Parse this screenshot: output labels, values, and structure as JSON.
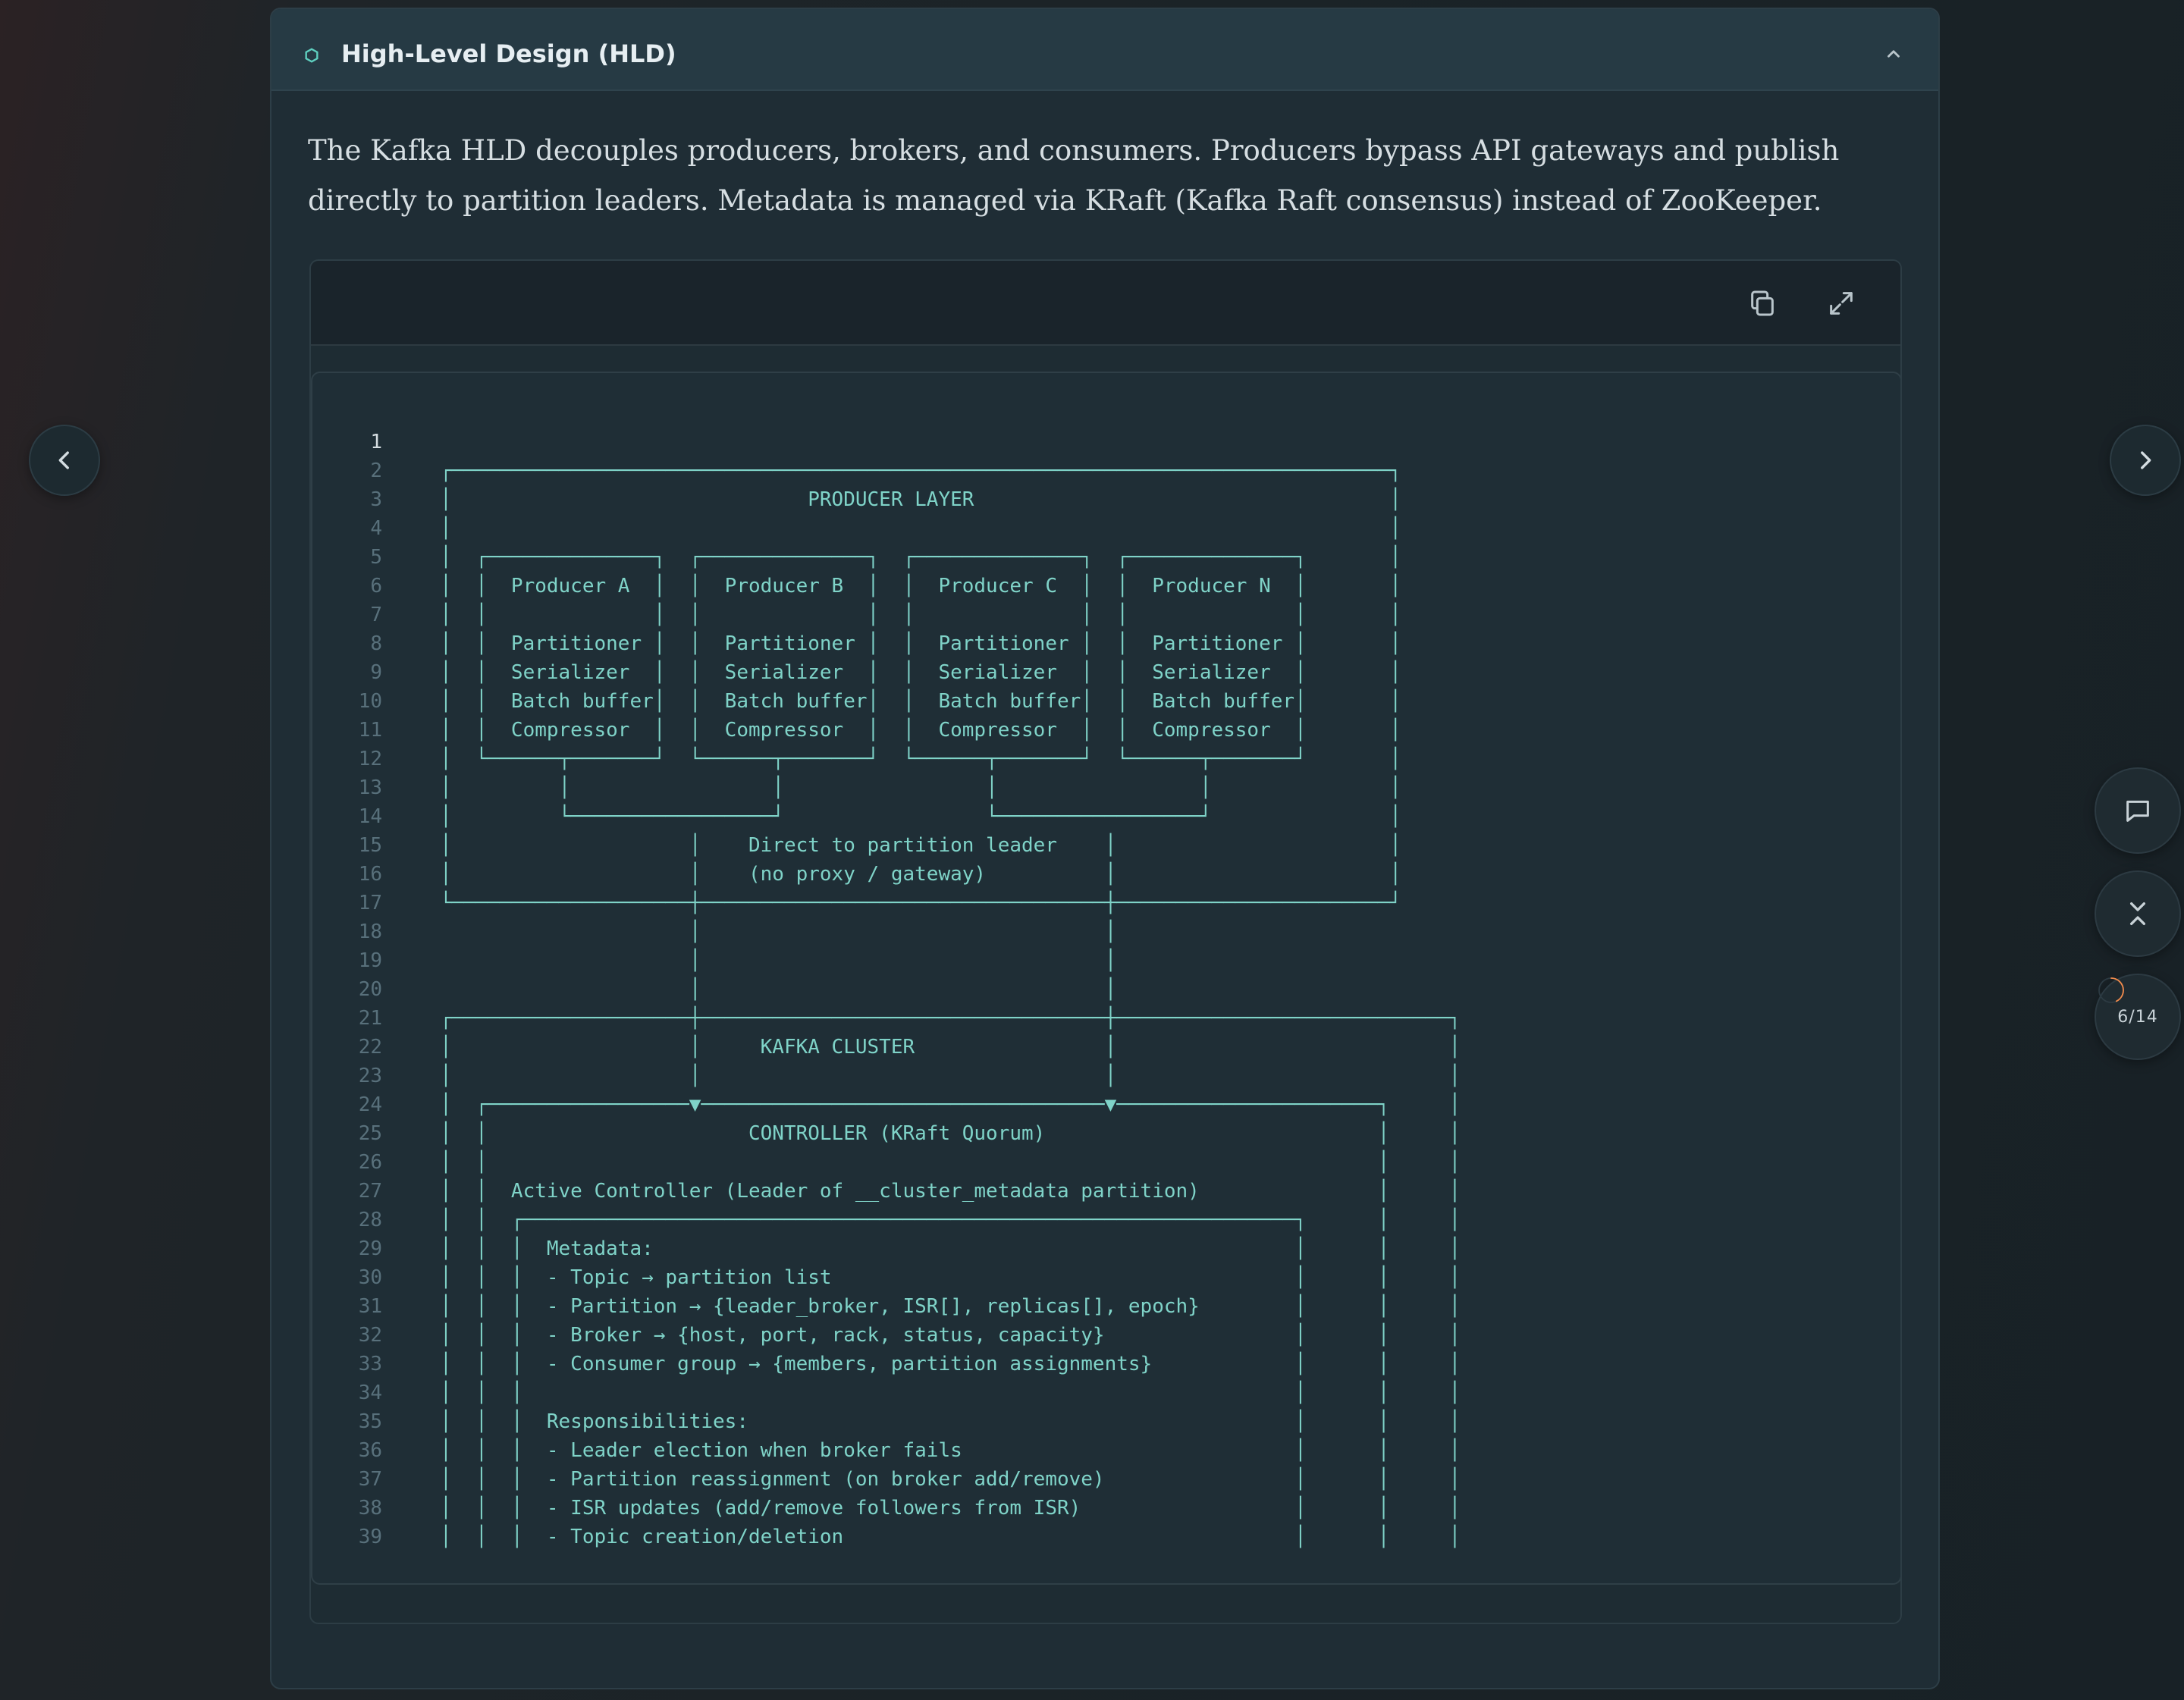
{
  "section": {
    "title": "High-Level Design (HLD)",
    "description": "The Kafka HLD decouples producers, brokers, and consumers. Producers bypass API gateways and publish directly to partition leaders. Metadata is managed via KRaft (Kafka Raft consensus) instead of ZooKeeper."
  },
  "navigation": {
    "progress": "6/14",
    "progress_fraction": 0.4286
  },
  "icons": {
    "section": "hexagon-icon",
    "collapse_section": "chevron-up-icon",
    "copy": "copy-icon",
    "expand": "expand-icon",
    "prev": "chevron-left-icon",
    "next": "chevron-right-icon",
    "comment": "comment-icon",
    "collapse_all": "collapse-all-icon"
  },
  "colors": {
    "accent_teal": "#7fd3c8",
    "progress_orange": "#f08a4b",
    "background": "#1f2d35"
  },
  "code": {
    "active_line": 1,
    "lines": [
      "",
      "┌───────────────────────────────────────────────────────────────────────────────┐",
      "│                              PRODUCER LAYER                                   │",
      "│                                                                               │",
      "│  ┌──────────────┐  ┌──────────────┐  ┌──────────────┐  ┌──────────────┐       │",
      "│  │  Producer A  │  │  Producer B  │  │  Producer C  │  │  Producer N  │       │",
      "│  │              │  │              │  │              │  │              │       │",
      "│  │  Partitioner │  │  Partitioner │  │  Partitioner │  │  Partitioner │       │",
      "│  │  Serializer  │  │  Serializer  │  │  Serializer  │  │  Serializer  │       │",
      "│  │  Batch buffer│  │  Batch buffer│  │  Batch buffer│  │  Batch buffer│       │",
      "│  │  Compressor  │  │  Compressor  │  │  Compressor  │  │  Compressor  │       │",
      "│  └──────┬───────┘  └──────┬───────┘  └──────┬───────┘  └──────┬───────┘       │",
      "│         │                 │                 │                 │               │",
      "│         └─────────────────┘                 └─────────────────┘               │",
      "│                    │    Direct to partition leader    │                       │",
      "│                    │    (no proxy / gateway)          │                       │",
      "└────────────────────┼──────────────────────────────────┼───────────────────────┘",
      "                     │                                  │",
      "                     │                                  │",
      "                     │                                  │",
      "┌────────────────────┼──────────────────────────────────┼────────────────────────────┐",
      "│                    │     KAFKA CLUSTER                │                            │",
      "│                    │                                  │                            │",
      "│  ┌─────────────────▼──────────────────────────────────▼──────────────────────┐     │",
      "│  │                      CONTROLLER (KRaft Quorum)                            │     │",
      "│  │                                                                           │     │",
      "│  │  Active Controller (Leader of __cluster_metadata partition)               │     │",
      "│  │  ┌─────────────────────────────────────────────────────────────────┐      │     │",
      "│  │  │  Metadata:                                                      │      │     │",
      "│  │  │  - Topic → partition list                                       │      │     │",
      "│  │  │  - Partition → {leader_broker, ISR[], replicas[], epoch}        │      │     │",
      "│  │  │  - Broker → {host, port, rack, status, capacity}                │      │     │",
      "│  │  │  - Consumer group → {members, partition assignments}            │      │     │",
      "│  │  │                                                                 │      │     │",
      "│  │  │  Responsibilities:                                              │      │     │",
      "│  │  │  - Leader election when broker fails                            │      │     │",
      "│  │  │  - Partition reassignment (on broker add/remove)                │      │     │",
      "│  │  │  - ISR updates (add/remove followers from ISR)                  │      │     │",
      "│  │  │  - Topic creation/deletion                                      │      │     │"
    ]
  }
}
